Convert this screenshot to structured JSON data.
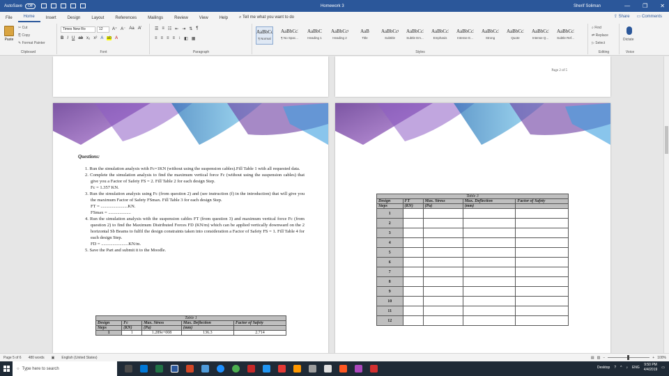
{
  "titlebar": {
    "autosave_label": "AutoSave",
    "autosave_state": "Off",
    "doc_title": "Homework 3",
    "user": "Sherif Soliman",
    "minimize": "—",
    "restore": "❐",
    "close": "✕"
  },
  "tabs": [
    "File",
    "Home",
    "Insert",
    "Design",
    "Layout",
    "References",
    "Mailings",
    "Review",
    "View",
    "Help"
  ],
  "tellme": "Tell me what you want to do",
  "share": "Share",
  "comments": "Comments",
  "clipboard": {
    "paste": "Paste",
    "cut": "Cut",
    "copy": "Copy",
    "format_painter": "Format Painter",
    "label": "Clipboard"
  },
  "font": {
    "name": "Times New Ro",
    "size": "12",
    "label": "Font"
  },
  "paragraph_label": "Paragraph",
  "styles_label": "Styles",
  "styles": [
    {
      "sample": "AaBbCcI",
      "name": "¶ Normal"
    },
    {
      "sample": "AaBbCcI",
      "name": "¶ No Spac..."
    },
    {
      "sample": "AaBbC",
      "name": "Heading 1"
    },
    {
      "sample": "AaBbCcC",
      "name": "Heading 2"
    },
    {
      "sample": "AaB",
      "name": "Title"
    },
    {
      "sample": "AaBbCcC",
      "name": "Subtitle"
    },
    {
      "sample": "AaBbCcD",
      "name": "Subtle Em..."
    },
    {
      "sample": "AaBbCcD",
      "name": "Emphasis"
    },
    {
      "sample": "AaBbCcD",
      "name": "Intense E..."
    },
    {
      "sample": "AaBbCcD",
      "name": "Strong"
    },
    {
      "sample": "AaBbCcI",
      "name": "Quote"
    },
    {
      "sample": "AaBbCcI",
      "name": "Intense Q..."
    },
    {
      "sample": "AaBbCcD",
      "name": "Subtle Ref..."
    }
  ],
  "editing": {
    "find": "Find",
    "replace": "Replace",
    "select": "Select",
    "label": "Editing"
  },
  "voice": {
    "dictate": "Dictate",
    "label": "Voice"
  },
  "page_number_text": "Page 2 of 5",
  "questions": {
    "heading": "Questions:",
    "items": [
      "1.  Run the simulation analysis with  Fc=1KN (without using the suspension cables).Fill Table 1 with all requested data.",
      "2.  Complete the simulation analysis to find the maximum vertical force  Fc (without using the suspension cables) that give you a Factor of Safety FS = 2. Fill Table 2 for each design Step.",
      "3.  Run the simulation analysis using Fc (from question 2) and (see instruction (f) in the introduction) that will give you the maximum Factor of Safety FSmax. Fill Table 3 for each design Step.",
      "4.  Run the simulation analysis with the suspension cables FT (from question 3) and maximum vertical force Fc (from question 2) to find the Maximum Distributed Forces FD (KN/m) which can be applied vertically downward on the 2 horizontal Sb Beams to fulfil the design constraints taken into consideration a Factor of Safety FS = 1. Fill Table 4 for each design Step.",
      "5.  Save the Part and submit it to the Moodle."
    ],
    "fc_value": "Fc = 1.357 KN.",
    "ft_line": "FT = ........................KN.",
    "fs_line": "FSmax = ....................",
    "fd_line": "FD = ........................KN/m."
  },
  "table1": {
    "caption": "Table 1",
    "headers": [
      "Design",
      "Fc",
      "Max. Stress",
      "Max. Deflection",
      "Factor of Safety"
    ],
    "subheaders": [
      "Steps",
      "(KN)",
      "(Pa)",
      "(mm)",
      ""
    ],
    "rows": [
      [
        "1",
        "1",
        "1.289e+008",
        "136.3",
        "2.714"
      ]
    ]
  },
  "table3": {
    "caption": "Table 3",
    "headers": [
      "Design",
      "FT",
      "Max. Stress",
      "Max. Deflection",
      "Factor of Safety"
    ],
    "subheaders": [
      "Steps",
      "(KN)",
      "(Pa)",
      "(mm)",
      ""
    ],
    "steps": [
      "1",
      "2",
      "3",
      "4",
      "5",
      "6",
      "7",
      "8",
      "9",
      "10",
      "11",
      "12"
    ]
  },
  "status": {
    "page": "Page 5 of 6",
    "words": "480 words",
    "language": "English (United States)",
    "zoom": "100%"
  },
  "taskbar": {
    "search_placeholder": "Type here to search",
    "desktop": "Desktop",
    "lang": "ENG",
    "time": "9:50 PM",
    "date": "4/4/2019"
  }
}
